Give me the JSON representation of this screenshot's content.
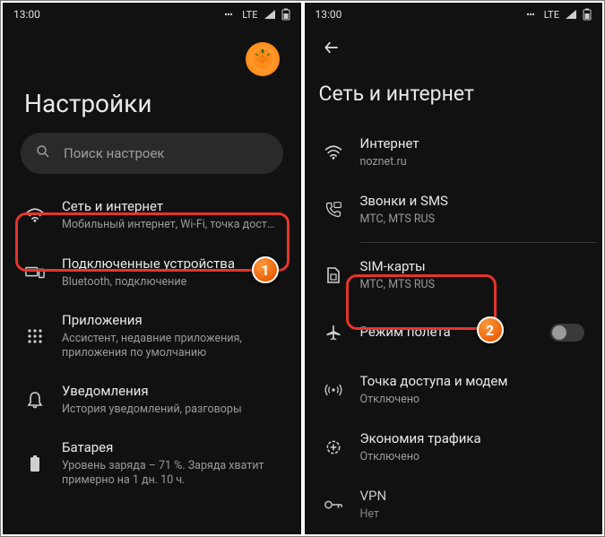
{
  "statusbar": {
    "time": "13:00",
    "network_label": "LTE"
  },
  "left": {
    "title": "Настройки",
    "search_placeholder": "Поиск настроек",
    "items": [
      {
        "icon": "wifi",
        "title": "Сеть и интернет",
        "sub": "Мобильный интернет, Wi-Fi, точка доступа"
      },
      {
        "icon": "devices",
        "title": "Подключенные устройства",
        "sub": "Bluetooth, подключение"
      },
      {
        "icon": "apps",
        "title": "Приложения",
        "sub": "Ассистент, недавние приложения, приложения по умолчанию"
      },
      {
        "icon": "notifications",
        "title": "Уведомления",
        "sub": "История уведомлений, разговоры"
      },
      {
        "icon": "battery",
        "title": "Батарея",
        "sub": "Уровень заряда – 71 %. Заряда хватит примерно на 1 дн. 10 ч."
      }
    ]
  },
  "right": {
    "title": "Сеть и интернет",
    "items": [
      {
        "icon": "wifi",
        "title": "Интернет",
        "sub": "noznet.ru"
      },
      {
        "icon": "phone",
        "title": "Звонки и SMS",
        "sub": "MTC, MTS RUS"
      },
      {
        "icon": "sim",
        "title": "SIM-карты",
        "sub": "MTC, MTS RUS"
      },
      {
        "icon": "airplane",
        "title": "Режим полета",
        "sub": "",
        "toggle": true
      },
      {
        "icon": "hotspot",
        "title": "Точка доступа и модем",
        "sub": "Отключено"
      },
      {
        "icon": "datasaver",
        "title": "Экономия трафика",
        "sub": "Отключено"
      },
      {
        "icon": "vpn",
        "title": "VPN",
        "sub": "Нет"
      }
    ]
  },
  "callouts": {
    "one": "1",
    "two": "2"
  }
}
